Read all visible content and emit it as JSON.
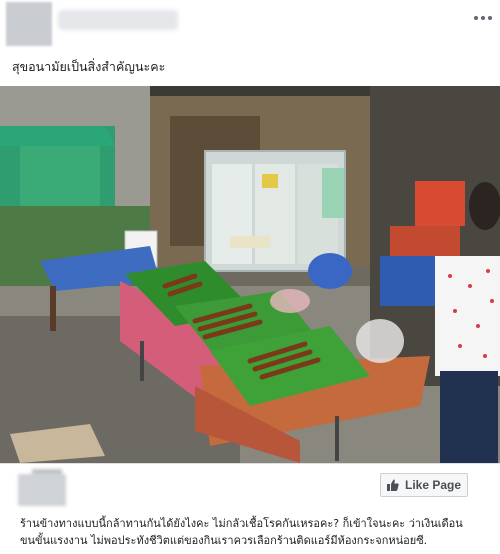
{
  "post": {
    "caption": "สุขอนามัยเป็นสิ่งสำคัญนะคะ",
    "more_icon": "more-horizontal-icon"
  },
  "photo": {
    "description_icon": "street-food-stall-photo"
  },
  "shared_card": {
    "like_button_label": "Like Page",
    "like_icon": "thumbs-up-icon",
    "text_line_1": "ร้านข้างทางแบบนี้กล้าทานกันได้ยังไงคะ ไม่กลัวเชื้อโรคกันเหรอคะ? ก็เข้าใจนะคะ ว่าเงินเดือน",
    "text_line_2": "ขนขั้นแรงงาน ไม่พอประทังชีวิตแต่ของกินเราควรเลือกร้านติดแอร์มีห้องกระจกหน่อยซี."
  },
  "colors": {
    "text": "#1c1e21",
    "button_border": "#ccd0d5",
    "button_text": "#4b4f56"
  }
}
